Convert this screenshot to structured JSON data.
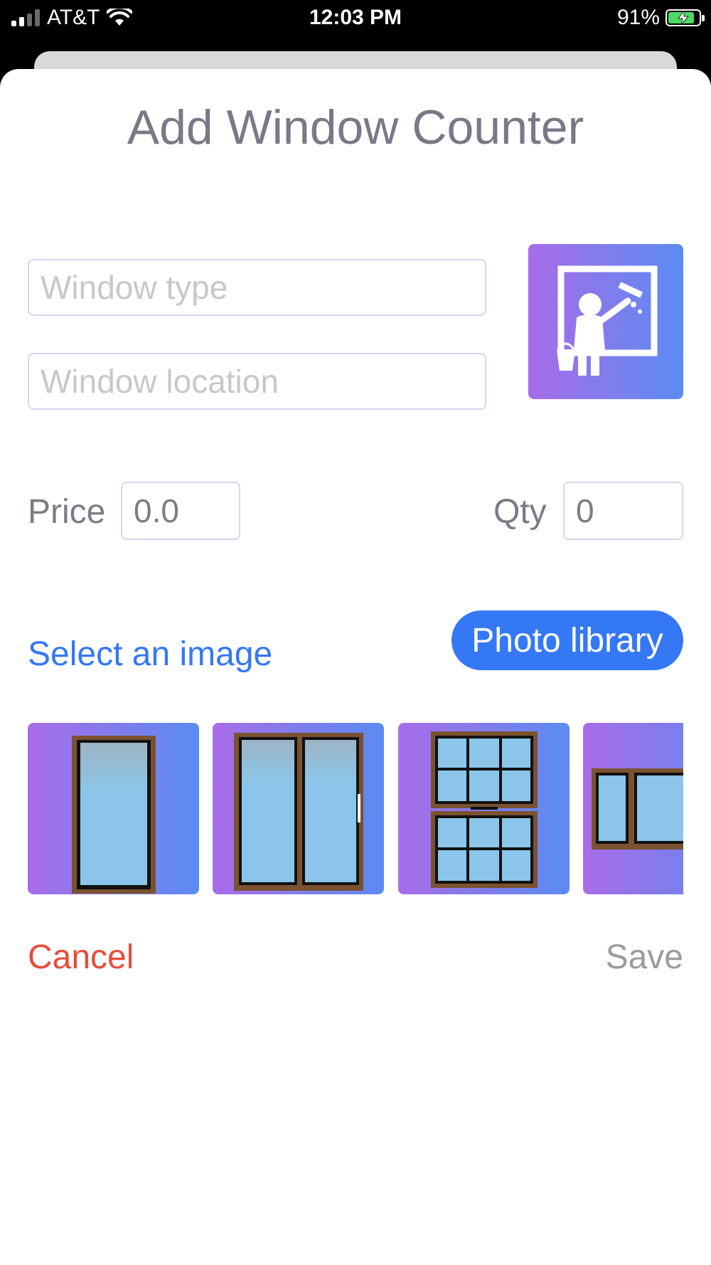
{
  "status_bar": {
    "carrier": "AT&T",
    "time": "12:03 PM",
    "battery": "91%",
    "battery_level": 0.91
  },
  "modal": {
    "title": "Add Window Counter",
    "window_type_placeholder": "Window type",
    "window_location_placeholder": "Window location",
    "price_label": "Price",
    "price_value": "0.0",
    "qty_label": "Qty",
    "qty_value": "0",
    "select_image_label": "Select an image",
    "photo_library_button": "Photo library",
    "cancel_button": "Cancel",
    "save_button": "Save"
  },
  "images": [
    {
      "icon": "single-window-icon"
    },
    {
      "icon": "double-window-icon"
    },
    {
      "icon": "grid-window-icon"
    },
    {
      "icon": "wide-window-icon"
    }
  ],
  "colors": {
    "accent": "#3478f6",
    "cancel": "#e74c3c",
    "save_disabled": "#9b9b9b",
    "gradient_start": "#a86ce8",
    "gradient_end": "#5b8cf2",
    "frame": "#7a5230",
    "glass": "#8bc6ea"
  }
}
